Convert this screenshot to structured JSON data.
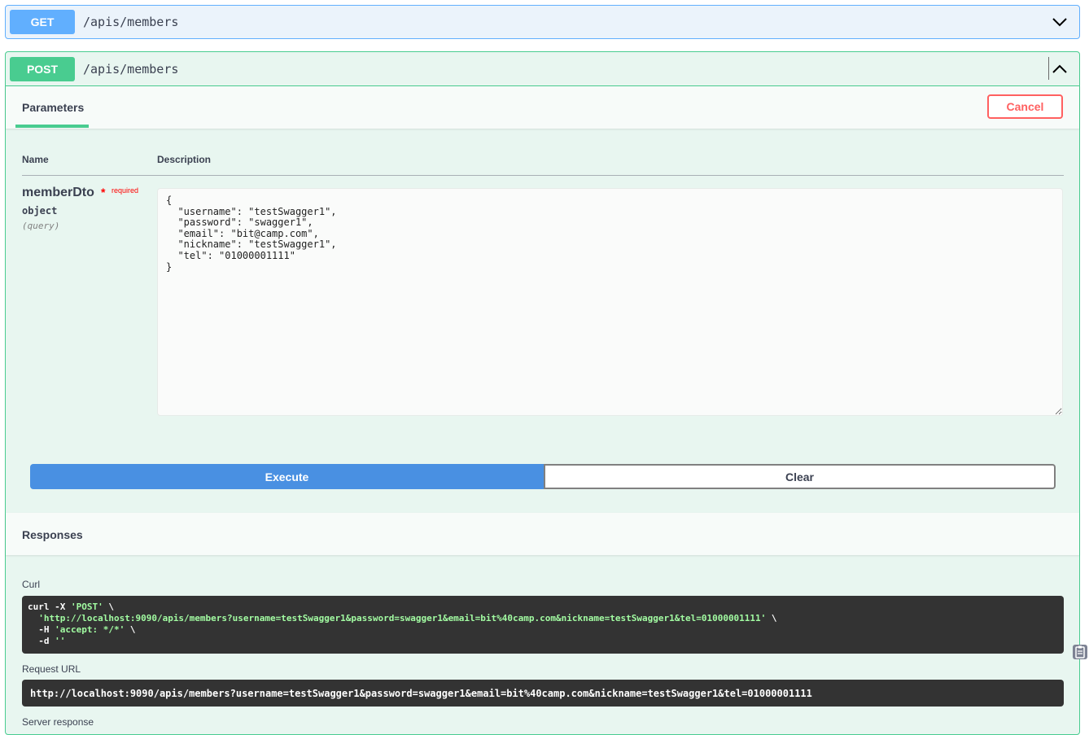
{
  "get_block": {
    "method": "GET",
    "path": "/apis/members"
  },
  "post_block": {
    "method": "POST",
    "path": "/apis/members",
    "parameters_tab": "Parameters",
    "cancel_label": "Cancel",
    "columns": {
      "name": "Name",
      "description": "Description"
    },
    "param": {
      "name": "memberDto",
      "required_star": "*",
      "required_label": "required",
      "type": "object",
      "in": "(query)",
      "body_value": "{\n  \"username\": \"testSwagger1\",\n  \"password\": \"swagger1\",\n  \"email\": \"bit@camp.com\",\n  \"nickname\": \"testSwagger1\",\n  \"tel\": \"01000001111\"\n}"
    },
    "execute_label": "Execute",
    "clear_label": "Clear",
    "responses_title": "Responses",
    "curl_label": "Curl",
    "curl_lines": {
      "line1_a": "curl -X ",
      "line1_b": "'POST'",
      "line1_c": " \\",
      "line2_a": "  ",
      "line2_b": "'http://localhost:9090/apis/members?username=testSwagger1&password=swagger1&email=bit%40camp.com&nickname=testSwagger1&tel=01000001111'",
      "line2_c": " \\",
      "line3_a": "  -H ",
      "line3_b": "'accept: */*'",
      "line3_c": " \\",
      "line4_a": "  -d ",
      "line4_b": "''"
    },
    "request_url_label": "Request URL",
    "request_url": "http://localhost:9090/apis/members?username=testSwagger1&password=swagger1&email=bit%40camp.com&nickname=testSwagger1&tel=01000001111",
    "server_response_label": "Server response"
  },
  "colors": {
    "get": "#61affe",
    "post": "#49cc90",
    "execute": "#4990e2",
    "cancel": "#ff6060"
  },
  "icons": {
    "get_toggle": "chevron-down-icon",
    "post_toggle": "chevron-up-icon",
    "copy": "copy-to-clipboard-icon"
  }
}
